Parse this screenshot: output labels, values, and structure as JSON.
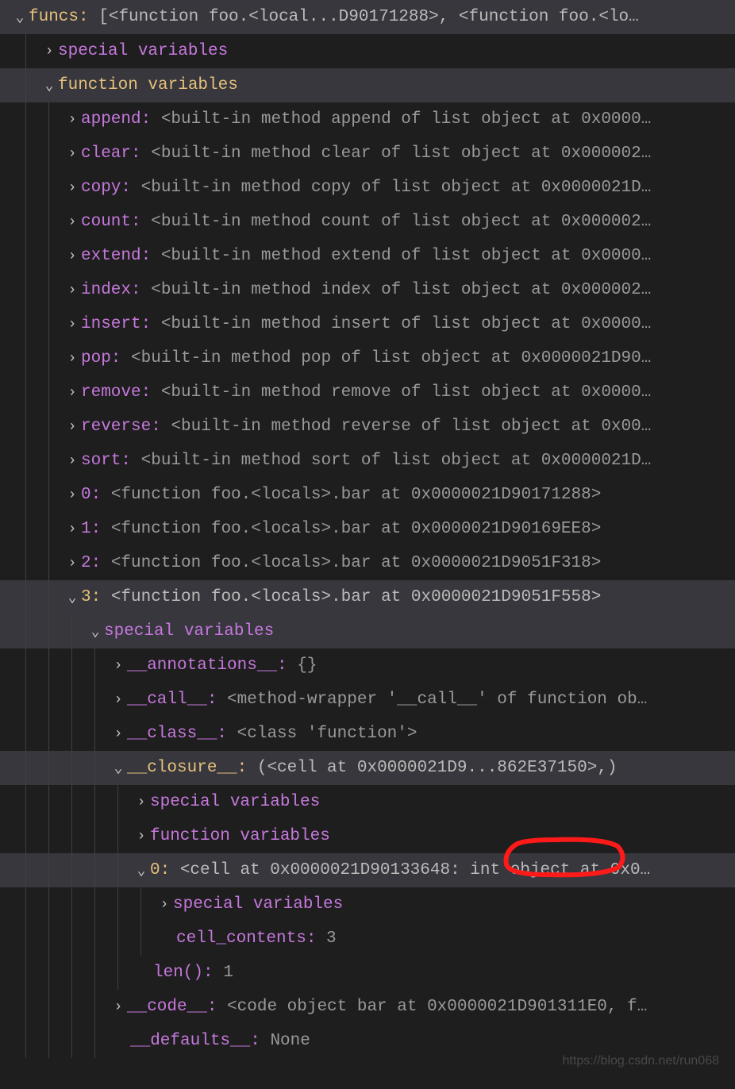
{
  "root": {
    "key": "funcs:",
    "val": "[<function foo.<local...D90171288>, <function foo.<lo…"
  },
  "special_vars": "special variables",
  "func_vars": "function variables",
  "methods": [
    {
      "key": "append:",
      "val": "<built-in method append of list object at 0x0000…"
    },
    {
      "key": "clear:",
      "val": "<built-in method clear of list object at 0x000002…"
    },
    {
      "key": "copy:",
      "val": "<built-in method copy of list object at 0x0000021D…"
    },
    {
      "key": "count:",
      "val": "<built-in method count of list object at 0x000002…"
    },
    {
      "key": "extend:",
      "val": "<built-in method extend of list object at 0x0000…"
    },
    {
      "key": "index:",
      "val": "<built-in method index of list object at 0x000002…"
    },
    {
      "key": "insert:",
      "val": "<built-in method insert of list object at 0x0000…"
    },
    {
      "key": "pop:",
      "val": "<built-in method pop of list object at 0x0000021D90…"
    },
    {
      "key": "remove:",
      "val": "<built-in method remove of list object at 0x0000…"
    },
    {
      "key": "reverse:",
      "val": "<built-in method reverse of list object at 0x00…"
    },
    {
      "key": "sort:",
      "val": "<built-in method sort of list object at 0x0000021D…"
    }
  ],
  "items": [
    {
      "key": "0:",
      "val": "<function foo.<locals>.bar at 0x0000021D90171288>"
    },
    {
      "key": "1:",
      "val": "<function foo.<locals>.bar at 0x0000021D90169EE8>"
    },
    {
      "key": "2:",
      "val": "<function foo.<locals>.bar at 0x0000021D9051F318>"
    }
  ],
  "item3": {
    "key": "3:",
    "val": "<function foo.<locals>.bar at 0x0000021D9051F558>"
  },
  "item3_special_vars": "special variables",
  "anno": {
    "key": "__annotations__:",
    "val": "{}"
  },
  "call": {
    "key": "__call__:",
    "val": "<method-wrapper '__call__' of function ob…"
  },
  "class": {
    "key": "__class__:",
    "val": "<class 'function'>"
  },
  "closure": {
    "key": "__closure__:",
    "val": "(<cell at 0x0000021D9...862E37150>,)"
  },
  "closure_special": "special variables",
  "closure_func": "function variables",
  "cell0": {
    "key": "0:",
    "pre": "<cell at 0x0000021D90133648: ",
    "mid": "int object",
    "post": " at 0x0…"
  },
  "cell_special": "special variables",
  "cell_contents": {
    "key": "cell_contents:",
    "val": "3"
  },
  "len": {
    "key": "len():",
    "val": "1"
  },
  "code": {
    "key": "__code__:",
    "val": "<code object bar at 0x0000021D901311E0, f…"
  },
  "defaults": {
    "key": "__defaults__:",
    "val": "None"
  },
  "watermark": "https://blog.csdn.net/run068"
}
